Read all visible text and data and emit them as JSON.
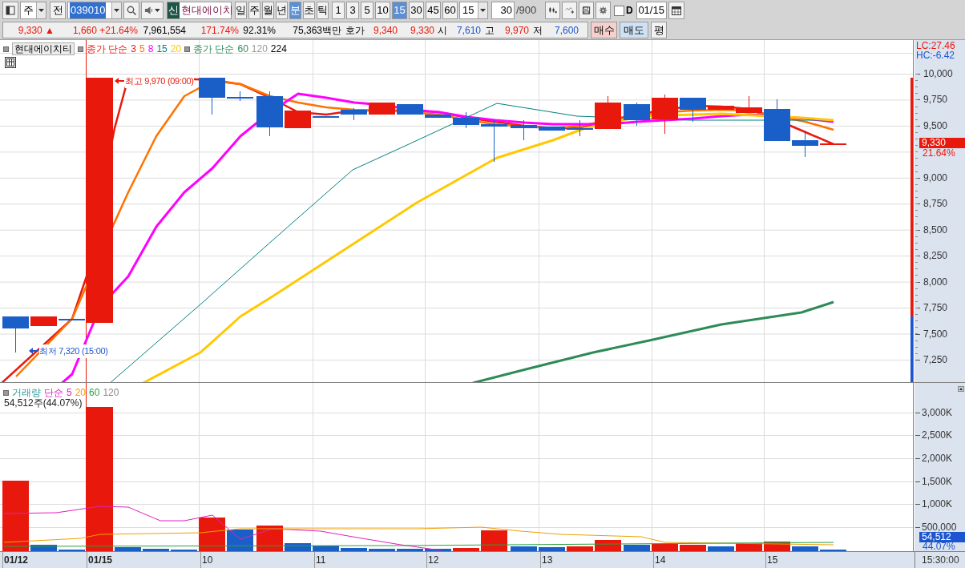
{
  "toolbar": {
    "market": "주",
    "prev": "전",
    "code": "039010",
    "badge": "신",
    "name": "현대에이치",
    "units": [
      {
        "label": "일",
        "selected": false
      },
      {
        "label": "주",
        "selected": false
      },
      {
        "label": "월",
        "selected": false
      },
      {
        "label": "년",
        "selected": false
      },
      {
        "label": "분",
        "selected": true
      },
      {
        "label": "초",
        "selected": false
      },
      {
        "label": "틱",
        "selected": false
      }
    ],
    "intervals": [
      {
        "label": "1",
        "selected": false
      },
      {
        "label": "3",
        "selected": false
      },
      {
        "label": "5",
        "selected": false
      },
      {
        "label": "10",
        "selected": false
      },
      {
        "label": "15",
        "selected": true
      },
      {
        "label": "30",
        "selected": false
      },
      {
        "label": "45",
        "selected": false
      },
      {
        "label": "60",
        "selected": false
      }
    ],
    "interval_select": "15",
    "count": "30",
    "count_max": "/900",
    "d_checkbox": {
      "label": "D",
      "checked": false
    },
    "date": "01/15"
  },
  "quote": {
    "cells": [
      {
        "text": "9,330 ▲",
        "color": "#e8190c"
      },
      {
        "text": "1,660 +21.64%",
        "color": "#e8190c"
      },
      {
        "text": "7,961,554"
      },
      {
        "text": "171.74%",
        "color": "#e8190c"
      },
      {
        "text": "92.31%"
      },
      {
        "text": "75,363백만"
      },
      {
        "text": "호가"
      },
      {
        "text": "9,340",
        "color": "#e8190c"
      },
      {
        "text": "9,330",
        "color": "#e8190c"
      },
      {
        "text": "시"
      },
      {
        "text": "7,610",
        "color": "#1d55d0"
      },
      {
        "text": "고"
      },
      {
        "text": "9,970",
        "color": "#e8190c"
      },
      {
        "text": "저"
      },
      {
        "text": "7,600",
        "color": "#1d55d0"
      }
    ],
    "buttons": [
      {
        "label": "매수",
        "kind": "buy"
      },
      {
        "label": "매도",
        "kind": "sell"
      },
      {
        "label": "평",
        "kind": "plain"
      }
    ]
  },
  "price_chart": {
    "legend_button": "현대에이치티",
    "legend_groups": [
      {
        "label": "종가 단순",
        "periods": [
          {
            "text": "3",
            "color": "#e8190c"
          },
          {
            "text": "5",
            "color": "#ff7200"
          },
          {
            "text": "8",
            "color": "#ff00ff"
          },
          {
            "text": "15",
            "color": "#008080"
          },
          {
            "text": "20",
            "color": "#ffc800"
          }
        ]
      },
      {
        "label": "종가 단순",
        "periods": [
          {
            "text": "60",
            "color": "#2e8b57"
          },
          {
            "text": "120",
            "color": "#999999"
          },
          {
            "text": "224",
            "color": "#000000"
          }
        ]
      }
    ],
    "annotations": [
      {
        "text": "최고 9,970 (09:00)",
        "kind": "high"
      },
      {
        "text": "최저 7,320 (15:00)",
        "kind": "low"
      }
    ],
    "axis": {
      "lc": "LC:27.46",
      "hc": "HC:-6.42",
      "ticks": [
        "10,000",
        "9,750",
        "9,500",
        "9,000",
        "8,750",
        "8,500",
        "8,250",
        "8,000",
        "7,750",
        "7,500",
        "7,250"
      ],
      "current_price": "9,330",
      "current_pct": "21.64%"
    }
  },
  "volume_chart": {
    "label": "거래량",
    "method": "단순",
    "periods": [
      {
        "text": "5",
        "color": "#e020c0"
      },
      {
        "text": "20",
        "color": "#f0a000"
      },
      {
        "text": "60",
        "color": "#28a040"
      },
      {
        "text": "120",
        "color": "#888888"
      }
    ],
    "current": "54,512주(44.07%)",
    "axis": {
      "ticks": [
        "3,000K",
        "2,500K",
        "2,000K",
        "1,500K",
        "1,000K",
        "500,000"
      ],
      "current_volume": "54,512",
      "current_pct": "44.07%"
    }
  },
  "x_axis": {
    "labels": [
      {
        "text": "01/12",
        "kind": "date"
      },
      {
        "text": "01/15",
        "kind": "date"
      },
      {
        "text": "10",
        "kind": "hour"
      },
      {
        "text": "11",
        "kind": "hour"
      },
      {
        "text": "12",
        "kind": "hour"
      },
      {
        "text": "13",
        "kind": "hour"
      },
      {
        "text": "14",
        "kind": "hour"
      },
      {
        "text": "15",
        "kind": "hour"
      }
    ],
    "time": "15:30:00"
  }
}
